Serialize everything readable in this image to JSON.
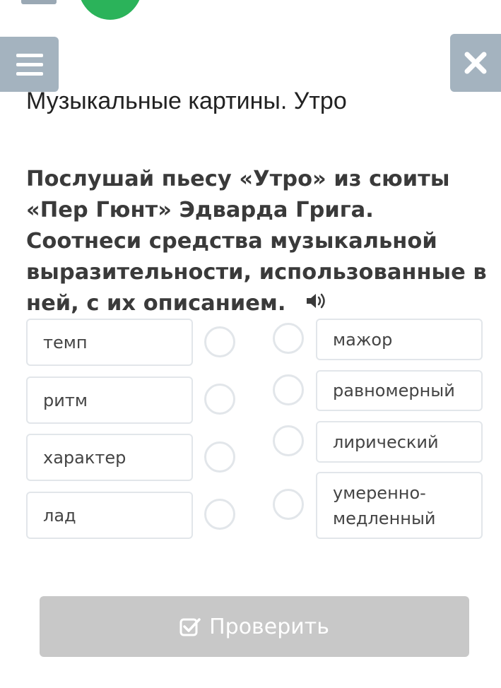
{
  "header": {
    "menu_icon": "hamburger-icon",
    "close_icon": "close-icon",
    "accent_color": "#2bb35a",
    "button_color": "#a4b3bf"
  },
  "lesson": {
    "title": "Музыкальные картины. Утро"
  },
  "question": {
    "text": "Послушай пьесу «Утро» из сюиты «Пер Гюнт» Эдварда Грига. Соотнеси средства музыкальной выразительности, использованные в ней, с их описанием.",
    "audio_icon": "speaker-icon"
  },
  "match": {
    "left": [
      "темп",
      "ритм",
      "характер",
      "лад"
    ],
    "right": [
      "мажор",
      "равномерный",
      "лирический",
      "умеренно-медленный"
    ]
  },
  "footer": {
    "check_label": "Проверить",
    "check_icon": "checkbox-icon"
  }
}
